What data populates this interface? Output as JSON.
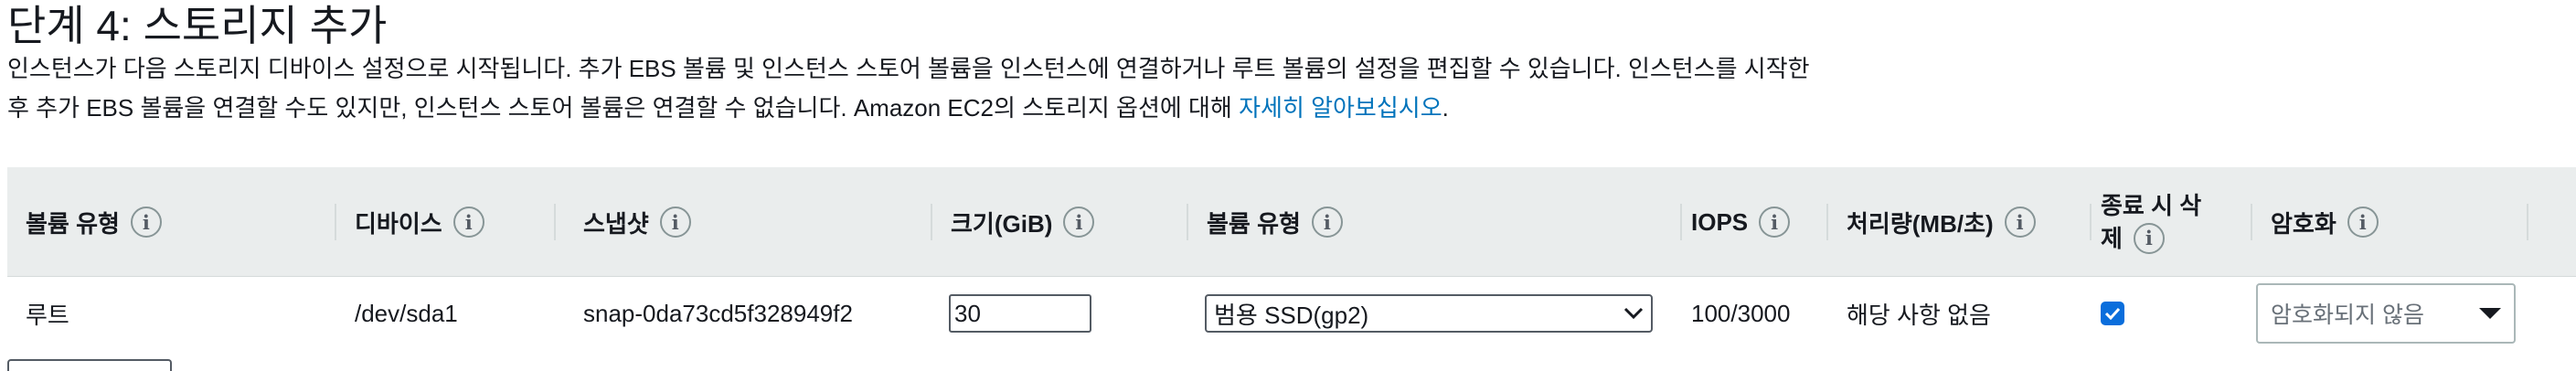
{
  "header": {
    "title": "단계 4: 스토리지 추가",
    "desc_line1": "인스턴스가 다음 스토리지 디바이스 설정으로 시작됩니다. 추가 EBS 볼륨 및 인스턴스 스토어 볼륨을 인스턴스에 연결하거나 루트 볼륨의 설정을 편집할 수 있습니다. 인스턴스를 시작한",
    "desc_line2": "후 추가 EBS 볼륨을 연결할 수도 있지만, 인스턴스 스토어 볼륨은 연결할 수 없습니다. Amazon EC2의 스토리지 옵션에 대해 ",
    "learn_more_link": "자세히 알아보십시오",
    "desc_end": "."
  },
  "table": {
    "headers": {
      "volume_type": "볼륨 유형",
      "device": "디바이스",
      "snapshot": "스냅샷",
      "size": "크기(GiB)",
      "ebs_volume_type": "볼륨 유형",
      "iops": "IOPS",
      "throughput": "처리량(MB/초)",
      "delete_on_termination_l1": "종료 시 삭",
      "delete_on_termination_l2": "제",
      "encryption": "암호화"
    },
    "info_glyph": "i",
    "rows": [
      {
        "volume_type": "루트",
        "device": "/dev/sda1",
        "snapshot": "snap-0da73cd5f328949f2",
        "size": "30",
        "ebs_volume_type": "범용 SSD(gp2)",
        "iops": "100/3000",
        "throughput": "해당 사항 없음",
        "delete_on_termination": true,
        "encryption": "암호화되지 않음"
      }
    ]
  },
  "colors": {
    "link": "#0073bb",
    "header_bg": "#eaeded",
    "checkbox": "#0a6edc"
  },
  "icons": [
    "info-icon",
    "chevron-down-icon",
    "caret-down-icon",
    "checkmark-icon"
  ]
}
